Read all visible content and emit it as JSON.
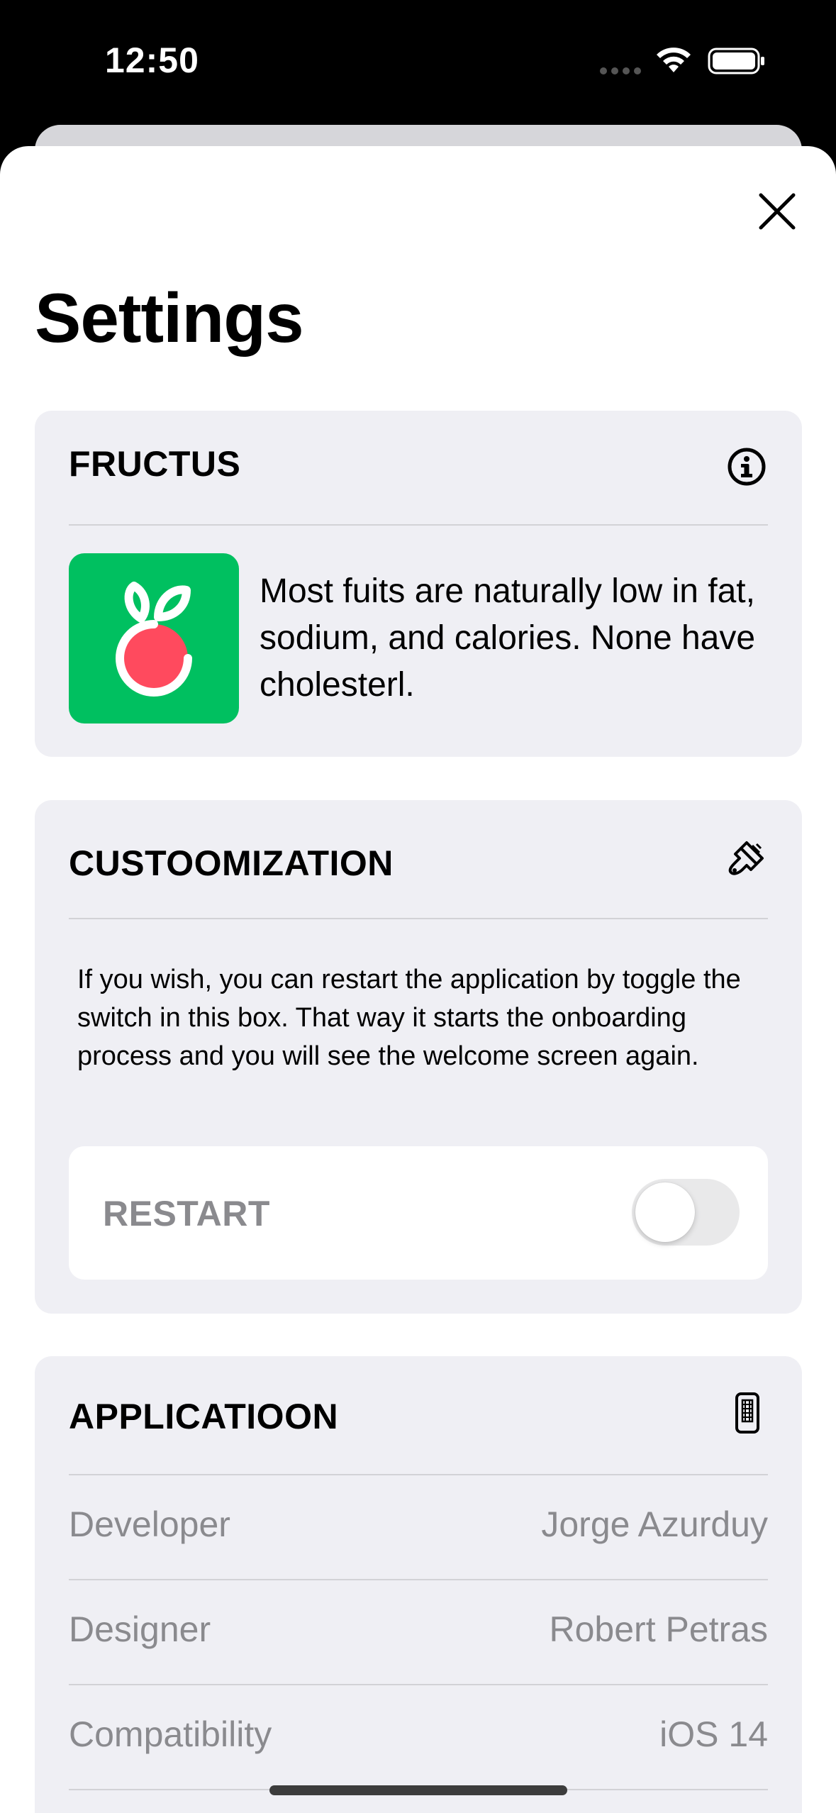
{
  "status_bar": {
    "time": "12:50",
    "icons": [
      "cellular-dots-icon",
      "wifi-icon",
      "battery-icon"
    ]
  },
  "header": {
    "title": "Settings",
    "close_icon": "close-icon"
  },
  "fructus": {
    "title": "FRUCTUS",
    "icon": "info-circle-icon",
    "logo_icon": "fructus-logo-icon",
    "description": "Most fuits are naturally low in fat, sodium, and calories. None have cholesterl."
  },
  "customization": {
    "title": "CUSTOOMIZATION",
    "icon": "paintbrush-icon",
    "description": "If you wish, you can restart the application by toggle the switch in this box. That way it starts the onboarding process and you will see the welcome screen again.",
    "restart_label": "RESTART",
    "restart_on": false
  },
  "application": {
    "title": "APPLICATIOON",
    "icon": "iphone-icon",
    "rows": [
      {
        "key": "Developer",
        "value": "Jorge Azurduy"
      },
      {
        "key": "Designer",
        "value": "Robert Petras"
      },
      {
        "key": "Compatibility",
        "value": "iOS 14"
      }
    ]
  },
  "colors": {
    "logo_background": "#00c060",
    "fruit_red": "#ff4a5e",
    "group_background": "#efeff4",
    "secondary_text": "#8a8a8e"
  }
}
